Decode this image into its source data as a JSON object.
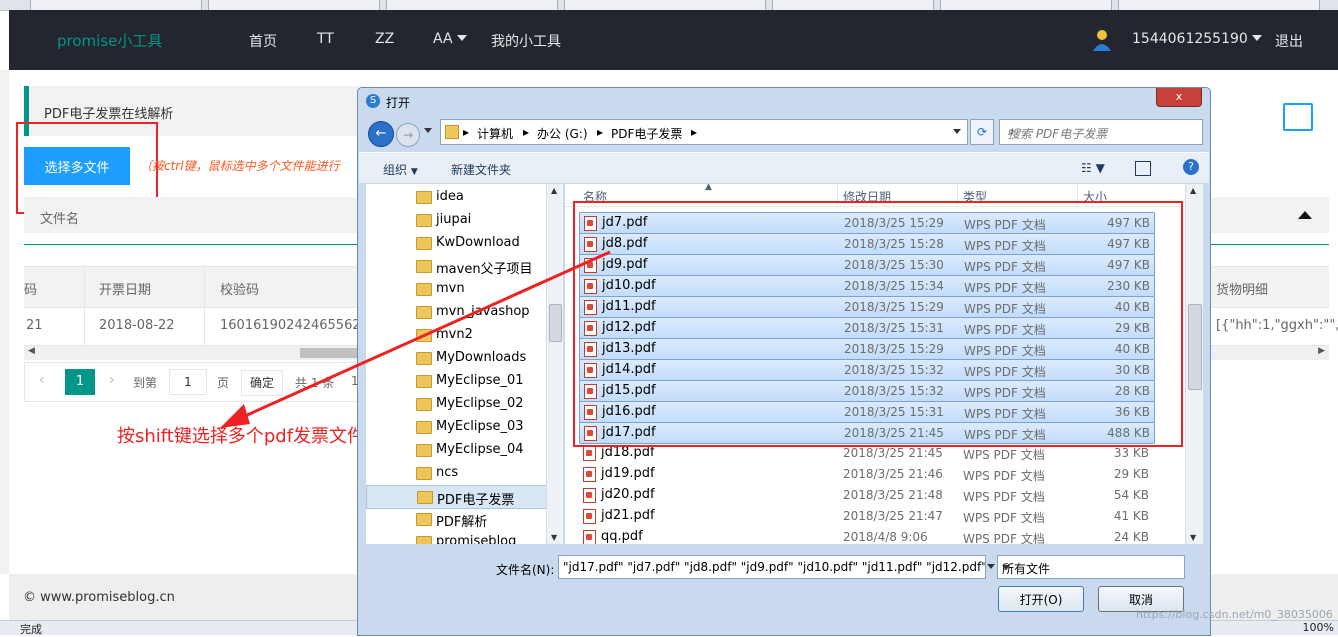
{
  "status_bar": {
    "text": "完成",
    "zoom": "100%"
  },
  "navbar": {
    "brand": "promise小工具",
    "items": [
      "首页",
      "TT",
      "ZZ",
      "AA",
      "我的小工具"
    ],
    "user": "1544061255190",
    "logout": "退出"
  },
  "page": {
    "section_title": "PDF电子发票在线解析",
    "upload_button": "选择多文件",
    "hint": "（按ctrl键，鼠标选中多个文件能进行",
    "file_list_label": "文件名",
    "table": {
      "headers": [
        "码",
        "开票日期",
        "校验码",
        "货物明细"
      ],
      "row": [
        "21",
        "2018-08-22",
        "16016190242465562",
        "[{\"hh\":1,\"ggxh\":\"\","
      ]
    },
    "pager": {
      "current": "1",
      "goto_label": "到第",
      "input_value": "1",
      "page_unit": "页",
      "confirm": "确定",
      "total": "共 1 条",
      "per_page": "1"
    },
    "annotation": "按shift键选择多个pdf发票文件导入",
    "footer": "© www.promiseblog.cn"
  },
  "dialog": {
    "title": "打开",
    "close_label": "x",
    "path": [
      "计算机",
      "办公 (G:)",
      "PDF电子发票"
    ],
    "search_placeholder": "搜索 PDF电子发票",
    "toolbar": {
      "organize": "组织",
      "new_folder": "新建文件夹"
    },
    "nav_items": [
      {
        "label": "idea"
      },
      {
        "label": "jiupai"
      },
      {
        "label": "KwDownload"
      },
      {
        "label": "maven父子项目"
      },
      {
        "label": "mvn"
      },
      {
        "label": "mvn_javashop"
      },
      {
        "label": "mvn2"
      },
      {
        "label": "MyDownloads"
      },
      {
        "label": "MyEclipse_01"
      },
      {
        "label": "MyEclipse_02"
      },
      {
        "label": "MyEclipse_03"
      },
      {
        "label": "MyEclipse_04"
      },
      {
        "label": "ncs"
      },
      {
        "label": "PDF电子发票"
      },
      {
        "label": "PDF解析"
      },
      {
        "label": "promiseblog"
      }
    ],
    "nav_selected": 13,
    "columns": [
      "名称",
      "修改日期",
      "类型",
      "大小"
    ],
    "files": [
      {
        "name": "jd7.pdf",
        "date": "2018/3/25 15:29",
        "type": "WPS PDF 文档",
        "size": "497 KB",
        "selected": true
      },
      {
        "name": "jd8.pdf",
        "date": "2018/3/25 15:28",
        "type": "WPS PDF 文档",
        "size": "497 KB",
        "selected": true
      },
      {
        "name": "jd9.pdf",
        "date": "2018/3/25 15:30",
        "type": "WPS PDF 文档",
        "size": "497 KB",
        "selected": true
      },
      {
        "name": "jd10.pdf",
        "date": "2018/3/25 15:34",
        "type": "WPS PDF 文档",
        "size": "230 KB",
        "selected": true
      },
      {
        "name": "jd11.pdf",
        "date": "2018/3/25 15:29",
        "type": "WPS PDF 文档",
        "size": "40 KB",
        "selected": true
      },
      {
        "name": "jd12.pdf",
        "date": "2018/3/25 15:31",
        "type": "WPS PDF 文档",
        "size": "29 KB",
        "selected": true
      },
      {
        "name": "jd13.pdf",
        "date": "2018/3/25 15:29",
        "type": "WPS PDF 文档",
        "size": "40 KB",
        "selected": true
      },
      {
        "name": "jd14.pdf",
        "date": "2018/3/25 15:32",
        "type": "WPS PDF 文档",
        "size": "30 KB",
        "selected": true
      },
      {
        "name": "jd15.pdf",
        "date": "2018/3/25 15:32",
        "type": "WPS PDF 文档",
        "size": "28 KB",
        "selected": true
      },
      {
        "name": "jd16.pdf",
        "date": "2018/3/25 15:31",
        "type": "WPS PDF 文档",
        "size": "36 KB",
        "selected": true
      },
      {
        "name": "jd17.pdf",
        "date": "2018/3/25 21:45",
        "type": "WPS PDF 文档",
        "size": "488 KB",
        "selected": true
      },
      {
        "name": "jd18.pdf",
        "date": "2018/3/25 21:45",
        "type": "WPS PDF 文档",
        "size": "33 KB",
        "selected": false
      },
      {
        "name": "jd19.pdf",
        "date": "2018/3/25 21:46",
        "type": "WPS PDF 文档",
        "size": "29 KB",
        "selected": false
      },
      {
        "name": "jd20.pdf",
        "date": "2018/3/25 21:48",
        "type": "WPS PDF 文档",
        "size": "54 KB",
        "selected": false
      },
      {
        "name": "jd21.pdf",
        "date": "2018/3/25 21:47",
        "type": "WPS PDF 文档",
        "size": "41 KB",
        "selected": false
      },
      {
        "name": "qq.pdf",
        "date": "2018/4/8 9:06",
        "type": "WPS PDF 文档",
        "size": "24 KB",
        "selected": false
      }
    ],
    "filename_label": "文件名(N):",
    "filename_value": "\"jd17.pdf\" \"jd7.pdf\" \"jd8.pdf\" \"jd9.pdf\" \"jd10.pdf\" \"jd11.pdf\" \"jd12.pdf\"",
    "filter": "所有文件",
    "open_button": "打开(O)",
    "cancel_button": "取消",
    "watermark": "https://blog.csdn.net/m0_38035006"
  },
  "colors": {
    "accent": "#009688",
    "primary_button": "#1e9fff",
    "annotation": "#ee2222",
    "navbar_bg": "#23262e"
  },
  "icons": [
    "user-avatar-icon",
    "edit-icon",
    "back-arrow-icon",
    "forward-arrow-icon",
    "refresh-icon",
    "search-icon",
    "help-icon",
    "folder-icon",
    "pdf-file-icon"
  ]
}
